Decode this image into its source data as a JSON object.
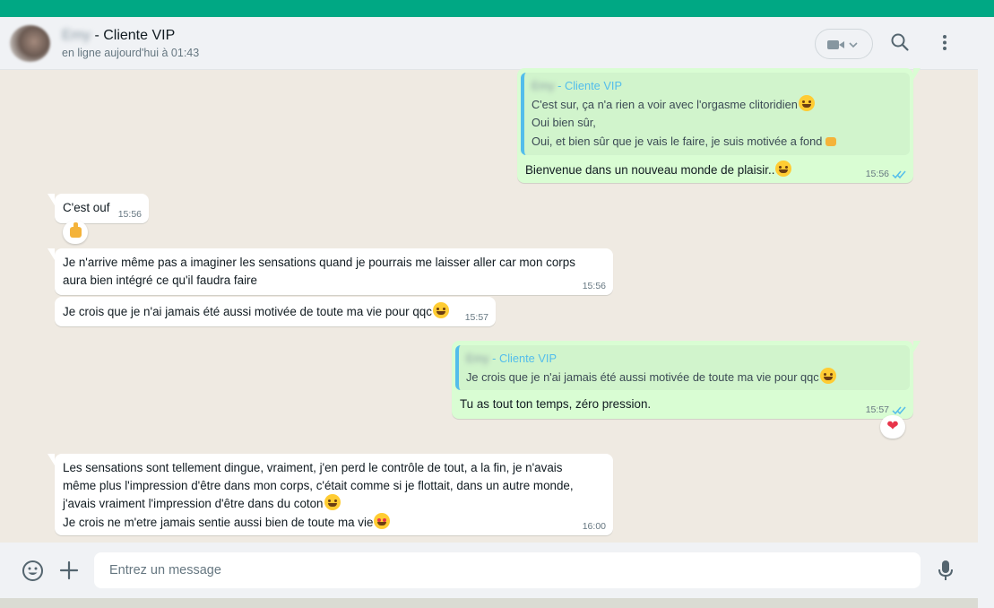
{
  "header": {
    "contact_name_blurred": "Emy",
    "contact_name_suffix": " - Cliente VIP",
    "status": "en ligne aujourd'hui à 01:43"
  },
  "messages": [
    {
      "direction": "out",
      "quote_author": " - Cliente VIP",
      "quote_lines": [
        "C'est sur, ça n'a rien a voir avec l'orgasme clitoridien",
        "Oui bien sûr,",
        "Oui, et bien sûr que je vais le faire, je suis motivée a fond"
      ],
      "text": "Bienvenue dans un nouveau monde de plaisir..",
      "time": "15:56"
    },
    {
      "direction": "in",
      "text": "C'est ouf",
      "time": "15:56",
      "reaction": "thumbs-up"
    },
    {
      "direction": "in",
      "text": "Je n'arrive même pas a imaginer les sensations quand je pourrais me laisser aller car mon corps aura bien intégré ce qu'il faudra faire",
      "time": "15:56"
    },
    {
      "direction": "in",
      "text": "Je crois que je n'ai jamais été aussi motivée de toute ma vie pour qqc",
      "time": "15:57"
    },
    {
      "direction": "out",
      "quote_author": " - Cliente VIP",
      "quote_lines": [
        "Je crois que je n'ai jamais été aussi motivée de toute ma vie pour qqc"
      ],
      "text": "Tu as tout ton temps, zéro pression.",
      "time": "15:57",
      "reaction": "heart"
    },
    {
      "direction": "in",
      "lines": [
        "Les sensations sont tellement dingue, vraiment, j'en perd le contrôle de tout, a la fin, je n'avais",
        "même plus l'impression d'être dans mon corps, c'était comme si je flottait, dans un autre monde,",
        "j'avais vraiment l'impression d'être dans du coton",
        "Je crois ne m'etre jamais sentie aussi bien de toute ma vie"
      ],
      "time": "16:00"
    }
  ],
  "footer": {
    "input_placeholder": "Entrez un message",
    "input_value": ""
  },
  "colors": {
    "accent": "#00a884",
    "outgoing_bubble": "#d9fdd3",
    "incoming_bubble": "#ffffff",
    "read_ticks": "#53bdeb"
  },
  "icons": [
    "video-call-icon",
    "chevron-down-icon",
    "search-icon",
    "menu-icon",
    "emoji-icon",
    "attach-icon",
    "microphone-icon"
  ]
}
